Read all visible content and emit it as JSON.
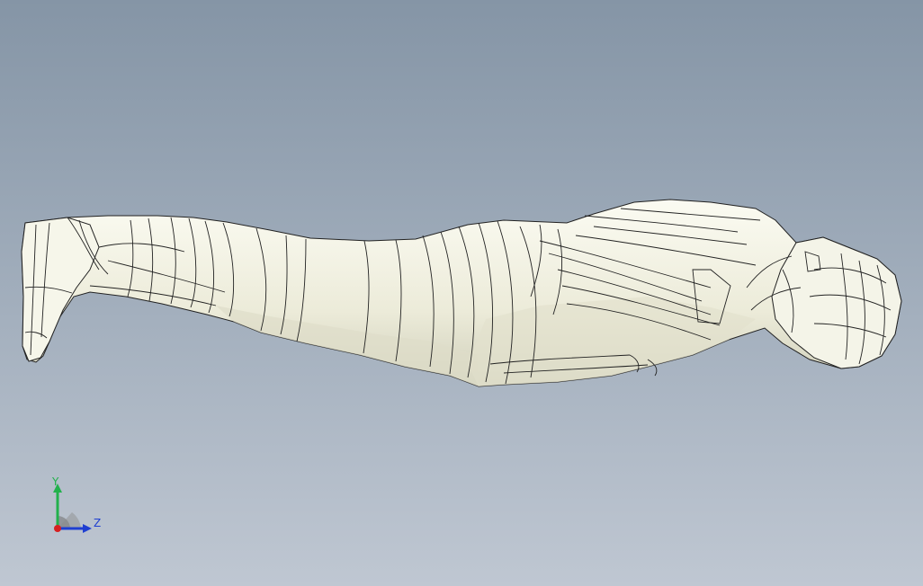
{
  "viewport": {
    "background_top": "#8595a6",
    "background_bottom": "#bfc7d2"
  },
  "model": {
    "surface_color": "#f2f2e4",
    "shade_color": "#d9d9c6",
    "edge_color": "#222222"
  },
  "triad": {
    "y_label": "Y",
    "z_label": "Z",
    "y_color": "#22b14c",
    "z_color": "#1f3fd1",
    "x_color": "#d62020"
  }
}
